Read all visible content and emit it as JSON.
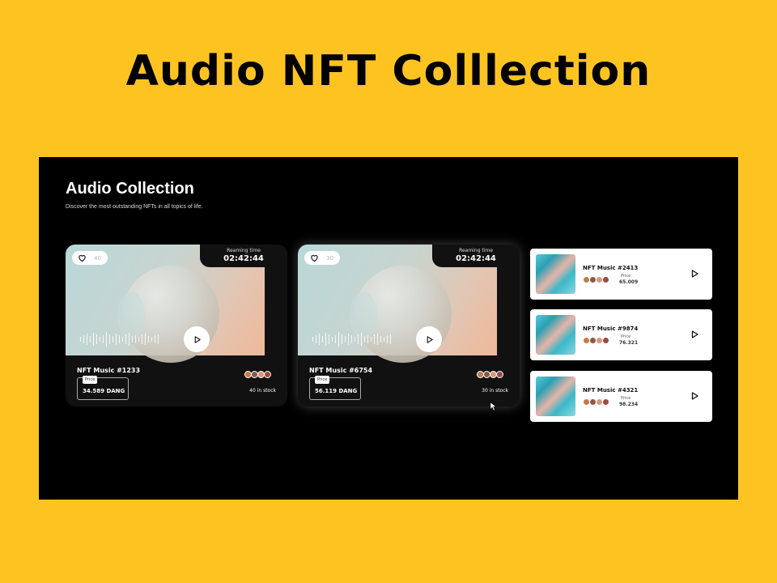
{
  "slide": {
    "title": "Audio NFT Colllection"
  },
  "header": {
    "title": "Audio Collection",
    "subtitle": "Discover the most outstanding NFTs in all topics of life."
  },
  "cards": [
    {
      "likes": "40",
      "timer_label": "Reaming time",
      "timer_value": "02:42:44",
      "name": "NFT Music #1233",
      "price_label": "Price",
      "price": "34.589 DANG",
      "stock": "40 in stock"
    },
    {
      "likes": "30",
      "timer_label": "Reaming time",
      "timer_value": "02:42:44",
      "name": "NFT Music #6754",
      "price_label": "Price",
      "price": "56.119 DANG",
      "stock": "30 in stock"
    }
  ],
  "side_items": [
    {
      "name": "NFT Music #2413",
      "price_label": "Price",
      "price": "65.009"
    },
    {
      "name": "NFT Music #9874",
      "price_label": "Price",
      "price": "76.321"
    },
    {
      "name": "NFT Music #4321",
      "price_label": "Price",
      "price": "98.234"
    }
  ],
  "icons": {
    "like": "heart-icon",
    "play": "play-icon",
    "cursor": "mouse-cursor-icon"
  },
  "colors": {
    "slide_bg": "#fdc421",
    "screen_bg": "#000000",
    "card_bg": "#111111"
  }
}
